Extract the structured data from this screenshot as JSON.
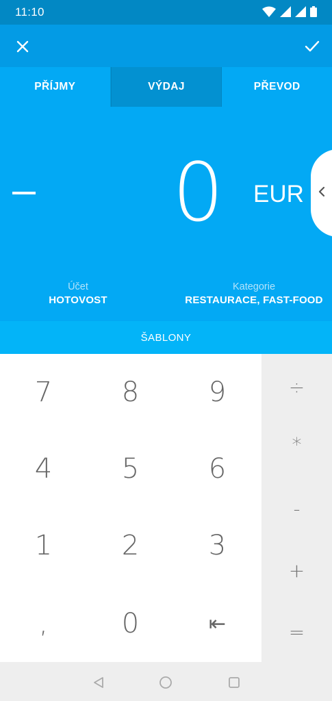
{
  "status_bar": {
    "time": "11:10"
  },
  "toolbar": {
    "close_icon": "close-icon",
    "confirm_icon": "check-icon"
  },
  "tabs": [
    {
      "label": "PŘÍJMY",
      "active": false
    },
    {
      "label": "VÝDAJ",
      "active": true
    },
    {
      "label": "PŘEVOD",
      "active": false
    }
  ],
  "amount": {
    "sign": "−",
    "value": "0",
    "currency": "EUR"
  },
  "account": {
    "label": "Účet",
    "value": "HOTOVOST"
  },
  "category": {
    "label": "Kategorie",
    "value": "RESTAURACE, FAST-FOOD"
  },
  "templates": {
    "label": "ŠABLONY"
  },
  "keypad": {
    "keys": [
      "7",
      "8",
      "9",
      "4",
      "5",
      "6",
      "1",
      "2",
      "3",
      ",",
      "0",
      "⇤"
    ]
  },
  "operators": [
    "÷",
    "*",
    "-",
    "+",
    "="
  ],
  "colors": {
    "primary": "#03a9f4",
    "primary_dark": "#0288c4",
    "toolbar": "#039be5"
  }
}
